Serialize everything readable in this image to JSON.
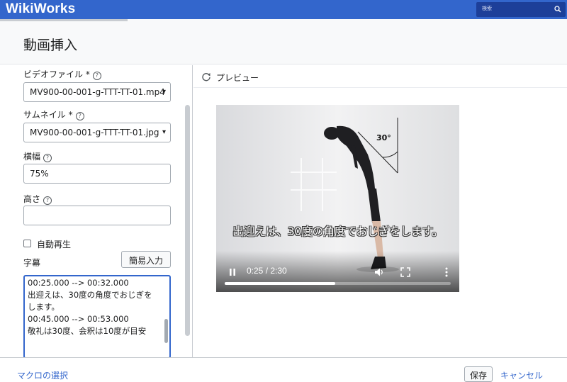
{
  "header": {
    "logo": "WikiWorks",
    "search_placeholder": "検索"
  },
  "page": {
    "title": "動画挿入"
  },
  "form": {
    "video_file": {
      "label": "ビデオファイル *",
      "value": "MV900-00-001-g-TTT-TT-01.mp4"
    },
    "thumbnail": {
      "label": "サムネイル *",
      "value": "MV900-00-001-g-TTT-TT-01.jpg"
    },
    "width": {
      "label": "横幅",
      "value": "75%"
    },
    "height": {
      "label": "高さ",
      "value": ""
    },
    "autoplay": {
      "label": "自動再生",
      "checked": false
    },
    "subtitles": {
      "label": "字幕",
      "quick_input_label": "簡易入力",
      "lines": [
        "00:25.000 --> 00:32.000",
        "出迎えは、30度の角度でおじぎを",
        "します。",
        "00:45.000 --> 00:53.000",
        "敬礼は30度、会釈は10度が目安"
      ]
    },
    "help_glyph": "?"
  },
  "preview": {
    "label": "プレビュー",
    "angle_label": "30°",
    "caption": "出迎えは、30度の角度でおじぎをします。",
    "time": "0:25 / 2:30",
    "progress": 0.49
  },
  "footer": {
    "macro_link": "マクロの選択",
    "save_label": "保存",
    "cancel_label": "キャンセル"
  },
  "colors": {
    "accent": "#3366cc",
    "header_bg": "#3366cc"
  }
}
